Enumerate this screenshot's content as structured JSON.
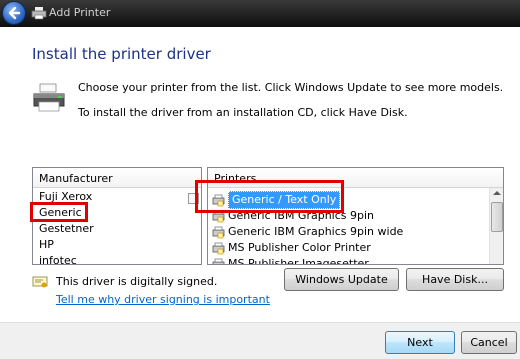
{
  "window": {
    "title": "Add Printer"
  },
  "heading": "Install the printer driver",
  "description": {
    "line1": "Choose your printer from the list. Click Windows Update to see more models.",
    "line2": "To install the driver from an installation CD, click Have Disk."
  },
  "manufacturer_list": {
    "header": "Manufacturer",
    "items": [
      "Fuji Xerox",
      "Generic",
      "Gestetner",
      "HP",
      "infotec"
    ],
    "selected": "Generic"
  },
  "printer_list": {
    "header": "Printers",
    "items": [
      "Generic / Text Only",
      "Generic IBM Graphics 9pin",
      "Generic IBM Graphics 9pin wide",
      "MS Publisher Color Printer",
      "MS Publisher Imagesetter"
    ],
    "selected": "Generic / Text Only"
  },
  "signing": {
    "status": "This driver is digitally signed.",
    "link": "Tell me why driver signing is important"
  },
  "buttons": {
    "windows_update": "Windows Update",
    "have_disk": "Have Disk...",
    "next": "Next",
    "cancel": "Cancel"
  },
  "colors": {
    "heading": "#1e3287",
    "selection": "#3399ff",
    "highlight_box": "#e00000",
    "link": "#0066cc"
  }
}
